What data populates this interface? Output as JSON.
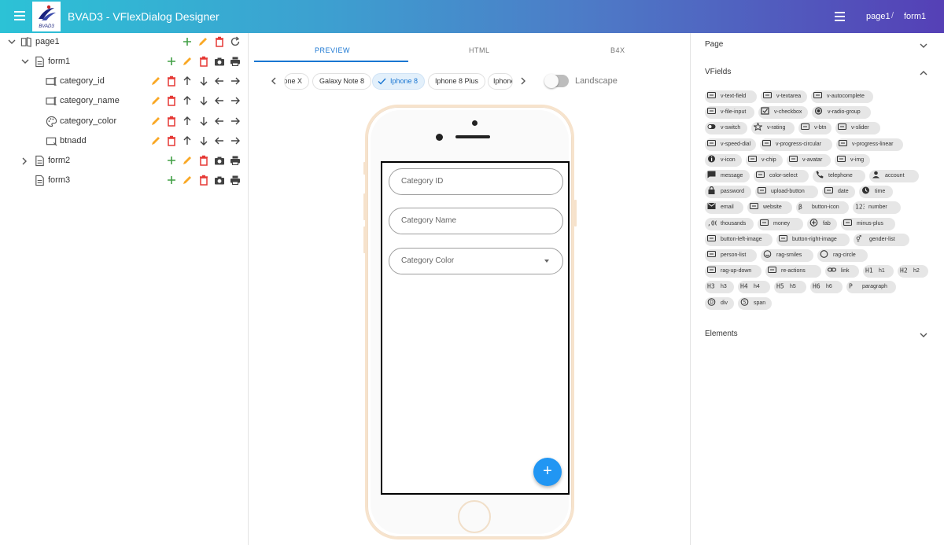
{
  "header": {
    "title": "BVAD3 - VFlexDialog Designer",
    "logo_text": "BVAD3",
    "breadcrumb": [
      "page1",
      "form1"
    ],
    "breadcrumb_separator": "/"
  },
  "tree": {
    "page": {
      "label": "page1",
      "expanded": true
    },
    "forms": [
      {
        "label": "form1",
        "expanded": true
      },
      {
        "label": "form2",
        "expanded": false
      },
      {
        "label": "form3",
        "expanded": false
      }
    ],
    "fields": [
      {
        "label": "category_id",
        "icon": "text-field-icon"
      },
      {
        "label": "category_name",
        "icon": "text-field-icon"
      },
      {
        "label": "category_color",
        "icon": "palette-icon"
      },
      {
        "label": "btnadd",
        "icon": "button-icon"
      }
    ]
  },
  "tabs": [
    {
      "label": "PREVIEW",
      "active": true
    },
    {
      "label": "HTML",
      "active": false
    },
    {
      "label": "B4X",
      "active": false
    }
  ],
  "devices": [
    {
      "label": "Iphone X",
      "selected": false
    },
    {
      "label": "Galaxy Note 8",
      "selected": false
    },
    {
      "label": "Iphone 8",
      "selected": true
    },
    {
      "label": "Iphone 8 Plus",
      "selected": false
    },
    {
      "label": "Iphone",
      "selected": false
    }
  ],
  "landscape": {
    "label": "Landscape",
    "on": false
  },
  "preview": {
    "fields": [
      {
        "placeholder": "Category ID"
      },
      {
        "placeholder": "Category Name"
      },
      {
        "placeholder": "Category Color",
        "type": "select"
      }
    ],
    "fab": "+"
  },
  "right": {
    "sections": [
      {
        "label": "Page",
        "expanded": false
      },
      {
        "label": "VFields",
        "expanded": true
      },
      {
        "label": "Elements",
        "expanded": false
      }
    ],
    "vfields": [
      "v-text-field",
      "v-textarea",
      "v-autocomplete",
      "v-file-input",
      "v-checkbox",
      "v-radio-group",
      "v-switch",
      "v-rating",
      "v-btn",
      "v-slider",
      "v-speed-dial",
      "v-progress-circular",
      "v-progress-linear",
      "v-icon",
      "v-chip",
      "v-avatar",
      "v-img",
      "message",
      "color-select",
      "telephone",
      "account",
      "password",
      "upload-button",
      "date",
      "time",
      "email",
      "website",
      "button-icon",
      "number",
      "thousands",
      "money",
      "fab",
      "minus-plus",
      "button-left-image",
      "button-right-image",
      "gender-list",
      "person-list",
      "rag-smiles",
      "rag-circle",
      "rag-up-down",
      "re-actions",
      "link",
      "h1",
      "h2",
      "h3",
      "h4",
      "h5",
      "h6",
      "paragraph",
      "div",
      "span"
    ]
  },
  "colors": {
    "header_gradient_start": "#2cc2d6",
    "header_gradient_end": "#5540b6",
    "accent": "#1976d2",
    "add": "#43a047",
    "edit": "#f9a825",
    "delete": "#e53935",
    "fab": "#2196f3"
  }
}
